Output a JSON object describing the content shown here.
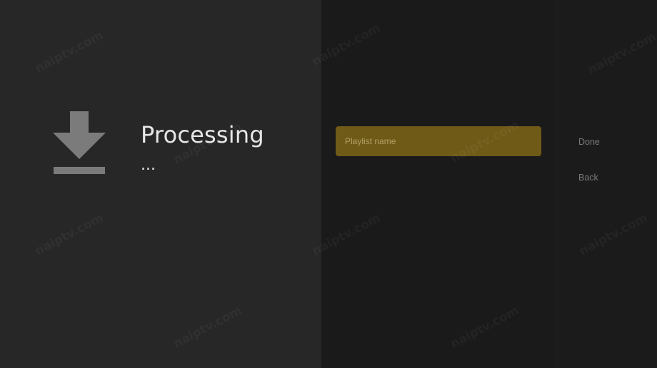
{
  "processing": {
    "title": "Processing",
    "subtitle": "...",
    "icon": "download-icon"
  },
  "playlist": {
    "name_placeholder": "Playlist name",
    "name_value": ""
  },
  "actions": {
    "done_label": "Done",
    "back_label": "Back"
  },
  "watermark": {
    "text": "naiptv.com"
  },
  "colors": {
    "left_panel": "#272727",
    "middle_panel": "#1a1a1a",
    "right_panel": "#1b1b1b",
    "field_background": "#6f5a17",
    "action_text": "#7a7a7a",
    "title_text": "#e6e6e6",
    "icon": "#7b7b7b"
  }
}
